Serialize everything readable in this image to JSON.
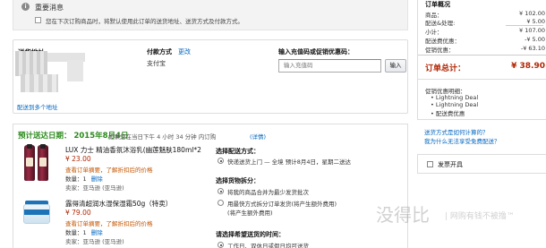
{
  "notice": {
    "title": "重要消息",
    "text": "您在下次订购商品时，将默认使用此订单的送货地址、送货方式及付款方式。"
  },
  "shipping": {
    "label": "送货地址",
    "link": "配送到多个地址"
  },
  "payment": {
    "heading": "付款方式",
    "change": "更改",
    "method": "支付宝"
  },
  "coupon": {
    "heading": "输入充值码或促销优惠码：",
    "placeholder": "输入充值码",
    "button": "输入"
  },
  "delivery": {
    "heading": "预计送达日期： 2015年8月4日",
    "note": "如果您在当日下午 4 小时 34 分钟 内订购",
    "detail": "(详情)"
  },
  "items": [
    {
      "title": "LUX 力士 精油香氛沐浴乳(幽莲魅肤180ml*2",
      "price": "¥ 23.00",
      "promo": "查看订单摘要，了解折扣后的价格",
      "qty": "数量：1",
      "remove": "删除",
      "seller": "卖家：亚马逊 (亚马逊)"
    },
    {
      "title": "露得清超润水湿保湿霜50g（特卖）",
      "price": "¥ 79.00",
      "promo": "查看订单摘要，了解折扣后的价格",
      "qty": "数量：1",
      "remove": "删除",
      "seller": "卖家：亚马逊 (亚马逊)"
    }
  ],
  "options": {
    "ship_method_head": "选择配送方式：",
    "ship_method": "快递送货上门 — 全境 预计8月4日，星期二送达",
    "group_head": "选择货物拆分：",
    "group_opt1": "将我的商品合并为最少发货批次",
    "group_opt2": "用最快方式拆分订单发货(将产生额外费用)",
    "group_opt2_link": "(将产生额外费用)",
    "time_head": "请选择希望送货的时间：",
    "time_opt": "工作日、双休日或假日均可送货"
  },
  "summary": {
    "title": "订单概况",
    "rows": [
      {
        "label": "商品：",
        "value": "¥ 102.00"
      },
      {
        "label": "配送&处理:",
        "value": "¥ 5.00"
      },
      {
        "label": "小计：",
        "value": "¥ 107.00"
      },
      {
        "label": "配送费优惠：",
        "value": "-¥ 5.00"
      },
      {
        "label": "促销优惠：",
        "value": "-¥ 63.10"
      }
    ],
    "total_label": "订单总计：",
    "total_value": "¥ 38.90",
    "promo_head": "促销优惠明细：",
    "promos": [
      "• Lightning Deal",
      "• Lightning Deal",
      "• 配送费优惠"
    ],
    "link1": "送货方式是如何计算的？",
    "link2": "我为什么无法享受免费配送？"
  },
  "invoice": {
    "label": "发票开具"
  },
  "watermark": {
    "main": "没得比",
    "sub": "| 网购有钱不被撸™"
  }
}
